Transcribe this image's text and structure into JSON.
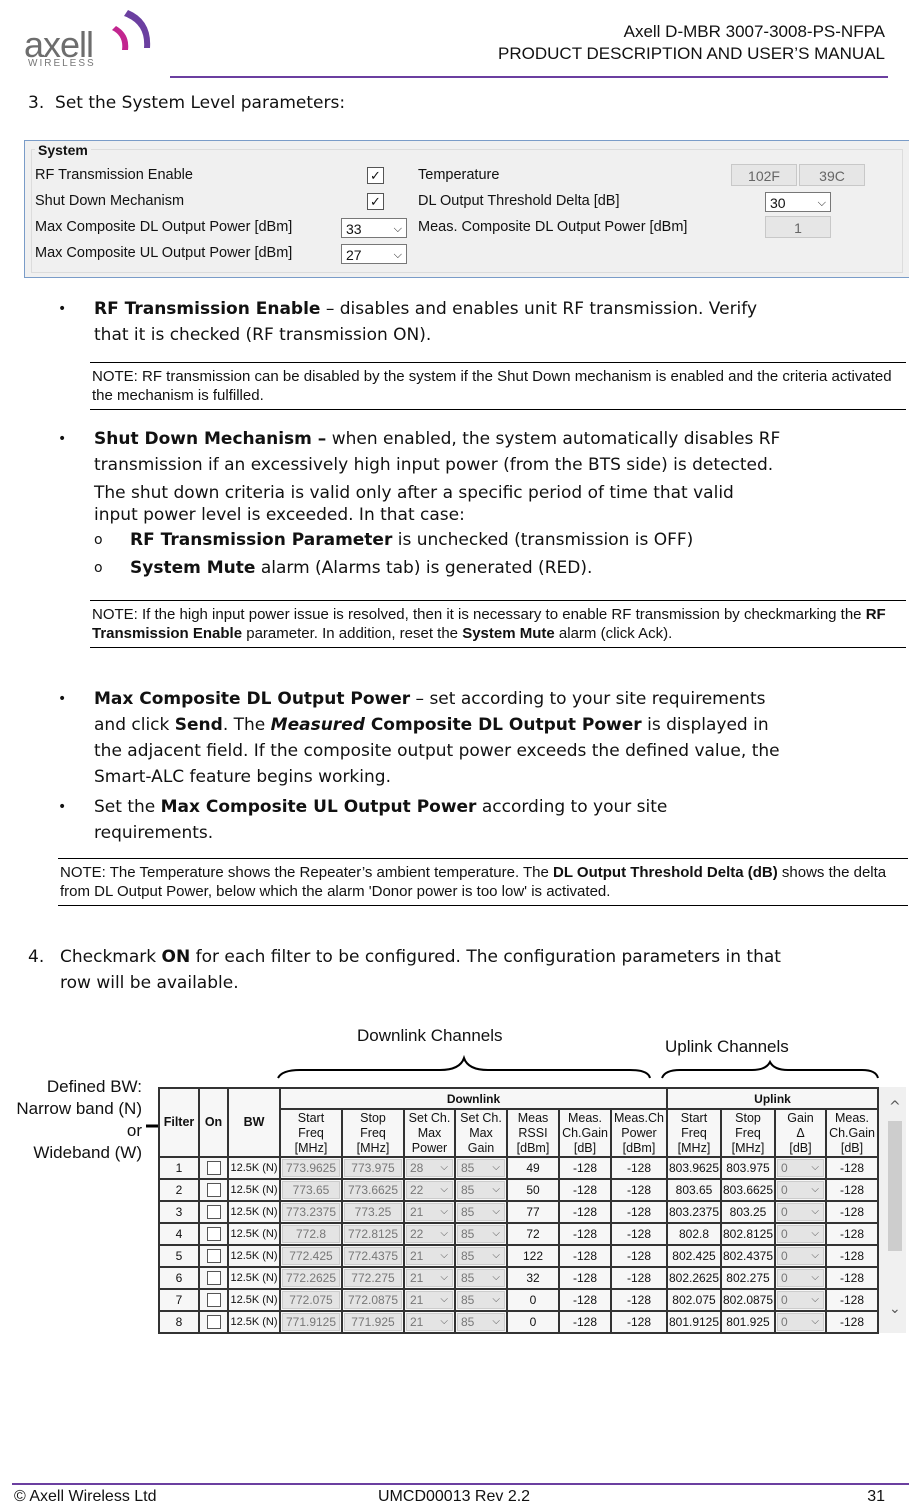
{
  "header": {
    "logo_text": "axell",
    "logo_sub": "WIRELESS",
    "title_line1": "Axell D-MBR 3007-3008-PS-NFPA",
    "title_line2": "PRODUCT DESCRIPTION AND USER’S MANUAL",
    "brand_color": "#6b3fa0"
  },
  "step3": {
    "number": "3.",
    "text": "Set the System Level parameters:"
  },
  "system_panel": {
    "title": "System",
    "rf_enable_label": "RF Transmission Enable",
    "rf_enable_checked": true,
    "shutdown_label": "Shut Down Mechanism",
    "shutdown_checked": true,
    "max_dl_label": "Max Composite DL Output Power [dBm]",
    "max_dl_value": "33",
    "max_ul_label": "Max Composite UL Output Power [dBm]",
    "max_ul_value": "27",
    "temp_label": "Temperature",
    "temp_f": "102F",
    "temp_c": "39C",
    "dl_threshold_label": "DL Output Threshold Delta [dB]",
    "dl_threshold_value": "30",
    "meas_dl_label": "Meas. Composite DL Output Power [dBm]",
    "meas_dl_value": "1",
    "check_glyph": "✓",
    "chevron_glyph": "⌵"
  },
  "bullets": {
    "rf": {
      "bold": "RF Transmission Enable",
      "text1": " – disables and enables unit RF transmission. Verify",
      "text2": "that it is checked (RF transmission ON)."
    },
    "note1": "NOTE: RF transmission can be disabled by the system if the Shut Down mechanism is enabled and the criteria activated the mechanism is fulfilled.",
    "sd": {
      "bold": "Shut Down Mechanism –",
      "text1": " when enabled, the system automatically disables RF",
      "text2": "transmission if an excessively high input power (from the BTS side) is detected.",
      "para1": "The shut down criteria is valid only after a specific period of time that valid",
      "para2": "input power level is exceeded. In that case:"
    },
    "sub1": {
      "bold": "RF Transmission Parameter",
      "text": " is unchecked (transmission is OFF)"
    },
    "sub2": {
      "bold": "System Mute",
      "text": " alarm (Alarms tab) is generated (RED)."
    },
    "note2": {
      "a": "NOTE:  If the high input power issue is resolved, then it is necessary to enable RF transmission by checkmarking the ",
      "b": "RF Transmission Enable",
      "c": " parameter. In addition,  reset the ",
      "d": "System Mute",
      "e": " alarm (click Ack)."
    },
    "dl": {
      "bold": "Max Composite DL Output Power",
      "t1": " – set according to your site requirements",
      "t2a": "and click ",
      "send": "Send",
      "t2b": ". The ",
      "measured": "Measured",
      "t2c": " Composite DL Output Power",
      "t2d": " is displayed in",
      "t3": "the adjacent field. If the composite output power exceeds the defined value, the",
      "t4": "Smart-ALC feature begins working."
    },
    "ul": {
      "pre": "Set the ",
      "bold": "Max Composite UL Output Power",
      "t1": " according to your site",
      "t2": "requirements."
    },
    "note3": {
      "a": "NOTE: The Temperature shows the Repeater’s ambient temperature. The ",
      "b": "DL Output Threshold Delta (dB)",
      "c": " shows the delta from DL Output Power, below which the alarm 'Donor power is too low' is activated."
    },
    "bullet_glyph": "•",
    "sub_glyph": "o"
  },
  "step4": {
    "number": "4.",
    "pre": "Checkmark ",
    "bold": "ON",
    "t1": " for each filter to be configured.  The configuration parameters in that",
    "t2": "row will be available."
  },
  "callouts": {
    "downlink": "Downlink Channels",
    "uplink": "Uplink Channels",
    "bw_line1": "Defined BW:",
    "bw_line2": "Narrow band (N)",
    "bw_line3": "or",
    "bw_line4": "Wideband (W)"
  },
  "filter_table": {
    "group_downlink": "Downlink",
    "group_uplink": "Uplink",
    "columns": {
      "filter": "Filter",
      "on": "On",
      "bw": "BW",
      "dl_start": [
        "Start",
        "Freq",
        "[MHz]"
      ],
      "dl_stop": [
        "Stop",
        "Freq",
        "[MHz]"
      ],
      "set_power": [
        "Set Ch.",
        "Max",
        "Power"
      ],
      "set_gain": [
        "Set Ch.",
        "Max",
        "Gain"
      ],
      "rssi": [
        "Meas",
        "RSSI",
        "[dBm]"
      ],
      "dl_gain": [
        "Meas.",
        "Ch.Gain",
        "[dB]"
      ],
      "dl_power": [
        "Meas.Ch",
        "Power",
        "[dBm]"
      ],
      "ul_start": [
        "Start",
        "Freq",
        "[MHz]"
      ],
      "ul_stop": [
        "Stop",
        "Freq",
        "[MHz]"
      ],
      "ul_gain_delta": [
        "Gain",
        "Δ",
        "[dB]"
      ],
      "ul_gain": [
        "Meas.",
        "Ch.Gain",
        "[dB]"
      ]
    },
    "rows": [
      {
        "filter": "1",
        "bw": "12.5K (N)",
        "dl_start": "773.9625",
        "dl_stop": "773.975",
        "power": "28",
        "gain": "85",
        "rssi": "49",
        "dl_gain": "-128",
        "dl_power": "-128",
        "ul_start": "803.9625",
        "ul_stop": "803.975",
        "ul_delta": "0",
        "ul_gain": "-128"
      },
      {
        "filter": "2",
        "bw": "12.5K (N)",
        "dl_start": "773.65",
        "dl_stop": "773.6625",
        "power": "22",
        "gain": "85",
        "rssi": "50",
        "dl_gain": "-128",
        "dl_power": "-128",
        "ul_start": "803.65",
        "ul_stop": "803.6625",
        "ul_delta": "0",
        "ul_gain": "-128"
      },
      {
        "filter": "3",
        "bw": "12.5K (N)",
        "dl_start": "773.2375",
        "dl_stop": "773.25",
        "power": "21",
        "gain": "85",
        "rssi": "77",
        "dl_gain": "-128",
        "dl_power": "-128",
        "ul_start": "803.2375",
        "ul_stop": "803.25",
        "ul_delta": "0",
        "ul_gain": "-128"
      },
      {
        "filter": "4",
        "bw": "12.5K (N)",
        "dl_start": "772.8",
        "dl_stop": "772.8125",
        "power": "22",
        "gain": "85",
        "rssi": "72",
        "dl_gain": "-128",
        "dl_power": "-128",
        "ul_start": "802.8",
        "ul_stop": "802.8125",
        "ul_delta": "0",
        "ul_gain": "-128"
      },
      {
        "filter": "5",
        "bw": "12.5K (N)",
        "dl_start": "772.425",
        "dl_stop": "772.4375",
        "power": "21",
        "gain": "85",
        "rssi": "122",
        "dl_gain": "-128",
        "dl_power": "-128",
        "ul_start": "802.425",
        "ul_stop": "802.4375",
        "ul_delta": "0",
        "ul_gain": "-128"
      },
      {
        "filter": "6",
        "bw": "12.5K (N)",
        "dl_start": "772.2625",
        "dl_stop": "772.275",
        "power": "21",
        "gain": "85",
        "rssi": "32",
        "dl_gain": "-128",
        "dl_power": "-128",
        "ul_start": "802.2625",
        "ul_stop": "802.275",
        "ul_delta": "0",
        "ul_gain": "-128"
      },
      {
        "filter": "7",
        "bw": "12.5K (N)",
        "dl_start": "772.075",
        "dl_stop": "772.0875",
        "power": "21",
        "gain": "85",
        "rssi": "0",
        "dl_gain": "-128",
        "dl_power": "-128",
        "ul_start": "802.075",
        "ul_stop": "802.0875",
        "ul_delta": "0",
        "ul_gain": "-128"
      },
      {
        "filter": "8",
        "bw": "12.5K (N)",
        "dl_start": "771.9125",
        "dl_stop": "771.925",
        "power": "21",
        "gain": "85",
        "rssi": "0",
        "dl_gain": "-128",
        "dl_power": "-128",
        "ul_start": "801.9125",
        "ul_stop": "801.925",
        "ul_delta": "0",
        "ul_gain": "-128"
      }
    ],
    "scroll_up_glyph": "^",
    "scroll_down_glyph": "⌄"
  },
  "footer": {
    "copyright": "© Axell Wireless Ltd",
    "doc_id": "UMCD00013 Rev 2.2",
    "page": "31"
  }
}
